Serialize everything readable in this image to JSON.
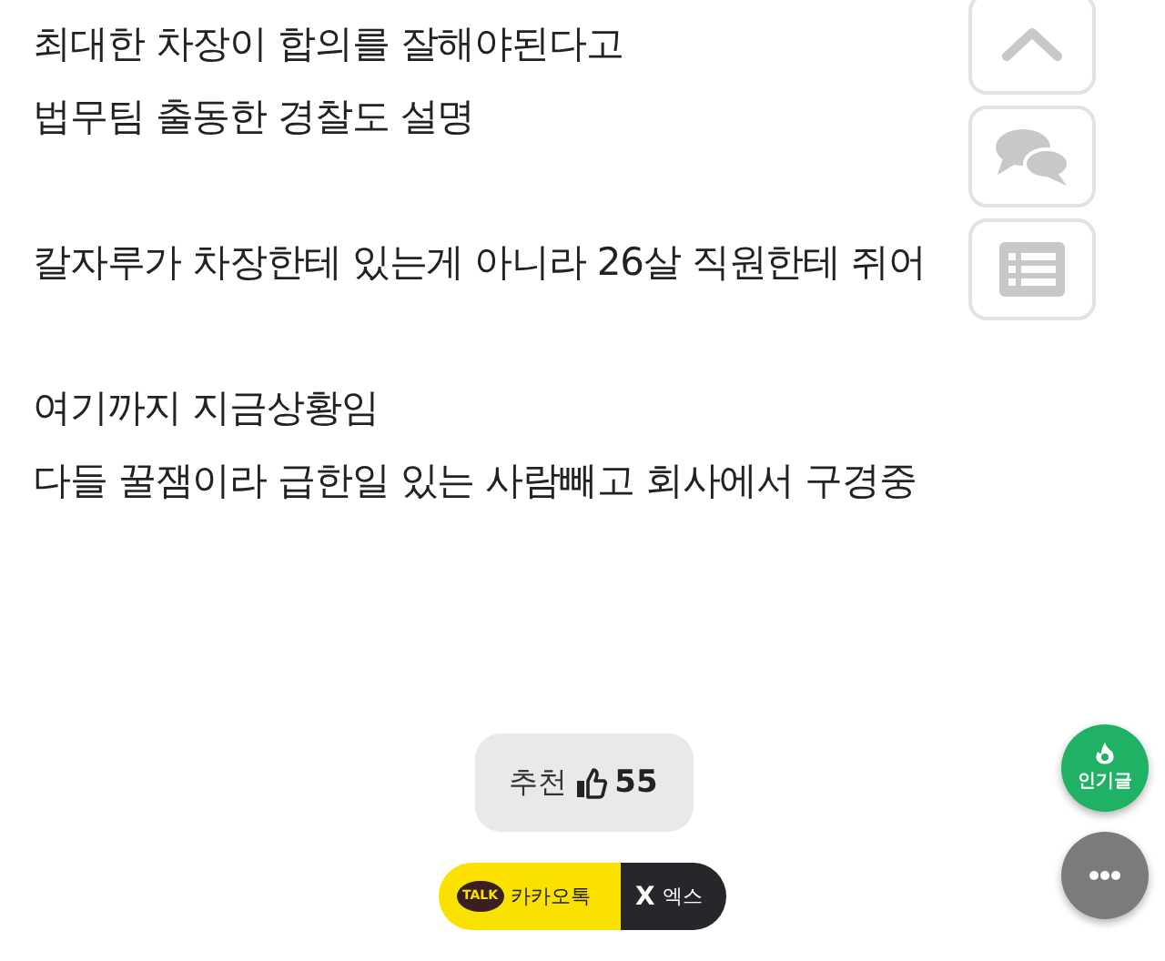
{
  "paragraphs": [
    {
      "lines": [
        "최대한 차장이 합의를 잘해야된다고",
        "법무팀 출동한 경찰도 설명"
      ]
    },
    {
      "lines": [
        "칼자루가 차장한테 있는게 아니라 26살 직원한테 쥐어"
      ]
    },
    {
      "lines": [
        "여기까지 지금상황임",
        "다들 꿀잼이라 급한일 있는 사람빼고 회사에서 구경중"
      ]
    }
  ],
  "side_buttons": [
    {
      "kind": "up"
    },
    {
      "kind": "comments"
    },
    {
      "kind": "list"
    }
  ],
  "recommend": {
    "label": "추천",
    "count": "55"
  },
  "share": [
    {
      "kind": "kakao",
      "logo": "TALK",
      "label": "카카오톡"
    },
    {
      "kind": "x",
      "logo": "X",
      "label": "엑스"
    }
  ],
  "popular_button": {
    "label": "인기글"
  }
}
